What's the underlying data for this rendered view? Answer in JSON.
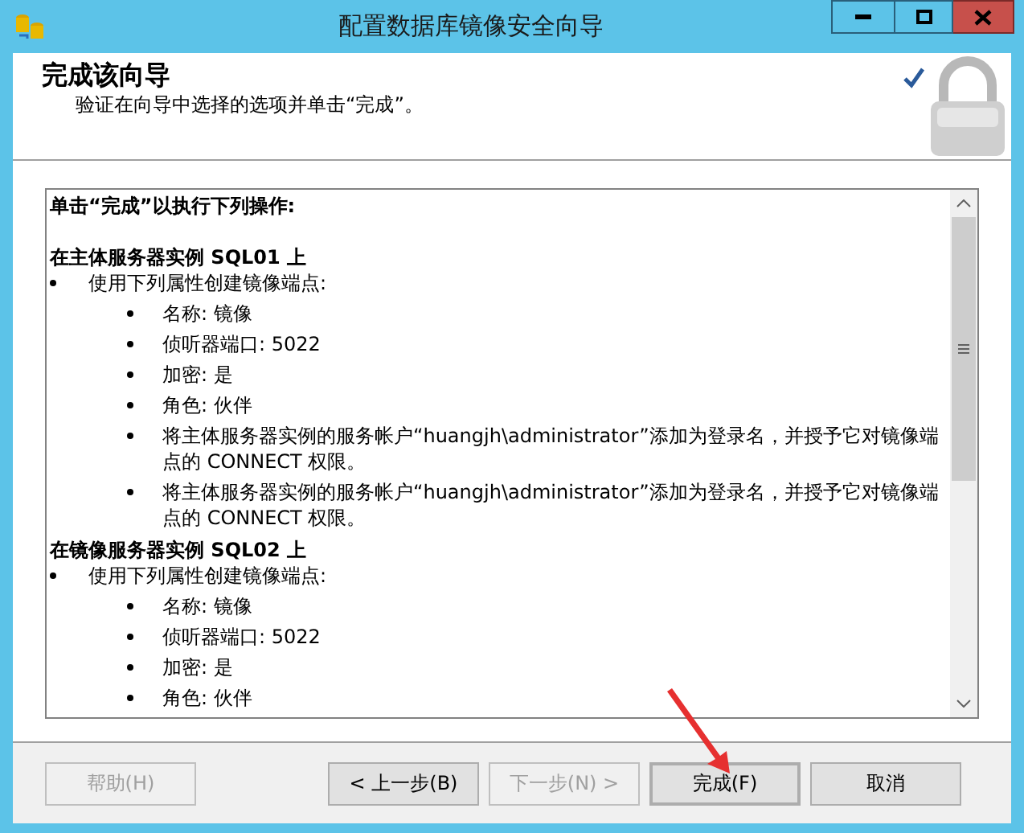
{
  "window": {
    "title": "配置数据库镜像安全向导"
  },
  "header": {
    "heading": "完成该向导",
    "subtitle": "验证在向导中选择的选项并单击“完成”。"
  },
  "summary": {
    "intro": "单击“完成”以执行下列操作:",
    "sections": [
      {
        "heading": "在主体服务器实例 SQL01 上",
        "items": [
          {
            "text": "使用下列属性创建镜像端点:",
            "children": [
              {
                "text": "名称: 镜像"
              },
              {
                "text": "侦听器端口: 5022"
              },
              {
                "text": "加密: 是"
              },
              {
                "text": "角色: 伙伴"
              },
              {
                "text": "将主体服务器实例的服务帐户“huangjh\\administrator”添加为登录名，并授予它对镜像端点的 CONNECT 权限。"
              },
              {
                "text": "将主体服务器实例的服务帐户“huangjh\\administrator”添加为登录名，并授予它对镜像端点的 CONNECT 权限。"
              }
            ]
          }
        ]
      },
      {
        "heading": "在镜像服务器实例 SQL02 上",
        "items": [
          {
            "text": "使用下列属性创建镜像端点:",
            "children": [
              {
                "text": "名称: 镜像"
              },
              {
                "text": "侦听器端口: 5022"
              },
              {
                "text": "加密: 是"
              },
              {
                "text": "角色: 伙伴"
              }
            ]
          }
        ]
      }
    ]
  },
  "buttons": [
    {
      "label": "帮助(H)",
      "disabled": true,
      "default": false
    },
    {
      "label": "< 上一步(B)",
      "disabled": false,
      "default": false
    },
    {
      "label": "下一步(N) >",
      "disabled": true,
      "default": false
    },
    {
      "label": "完成(F)",
      "disabled": false,
      "default": true
    },
    {
      "label": "取消",
      "disabled": false,
      "default": false
    }
  ]
}
